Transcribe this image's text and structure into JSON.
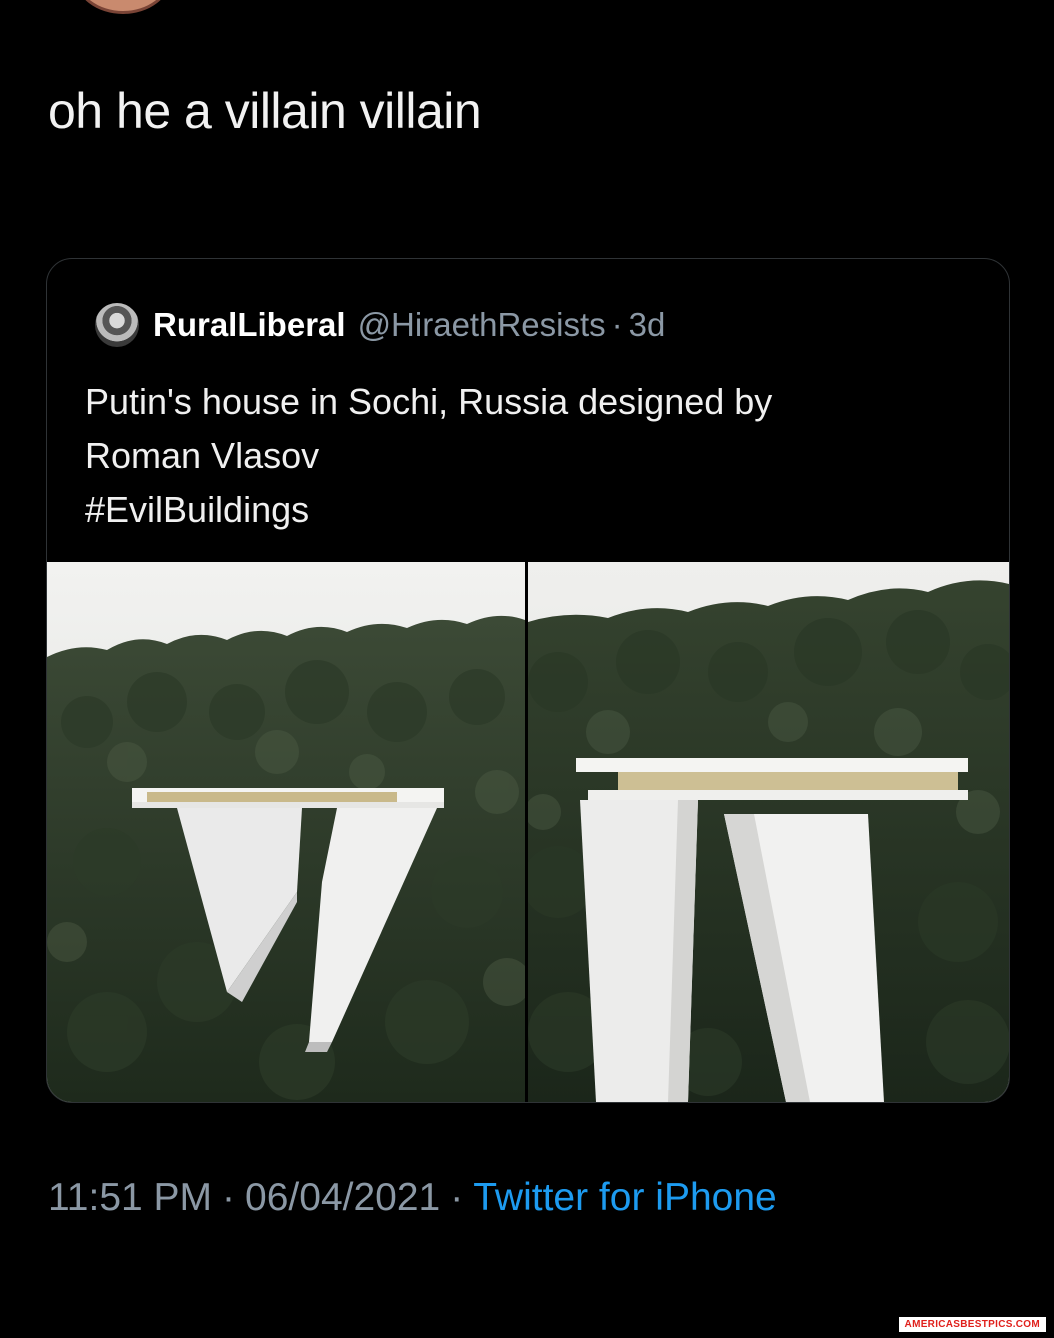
{
  "tweet": {
    "text": "oh he a villain villain"
  },
  "quoted": {
    "name": "RuralLiberal",
    "handle": "@HiraethResists",
    "separator": "·",
    "age": "3d",
    "lines": [
      "Putin's house in Sochi, Russia designed by",
      "Roman Vlasov",
      "#EvilBuildings"
    ]
  },
  "footer": {
    "time": "11:51 PM",
    "date": "06/04/2021",
    "separator": "·",
    "source": "Twitter for iPhone"
  },
  "watermark": "AMERICASBESTPICS.COM",
  "colors": {
    "background": "#000000",
    "muted_text": "#8b98a5",
    "link": "#1d9bf0",
    "card_border": "#2f3336"
  }
}
